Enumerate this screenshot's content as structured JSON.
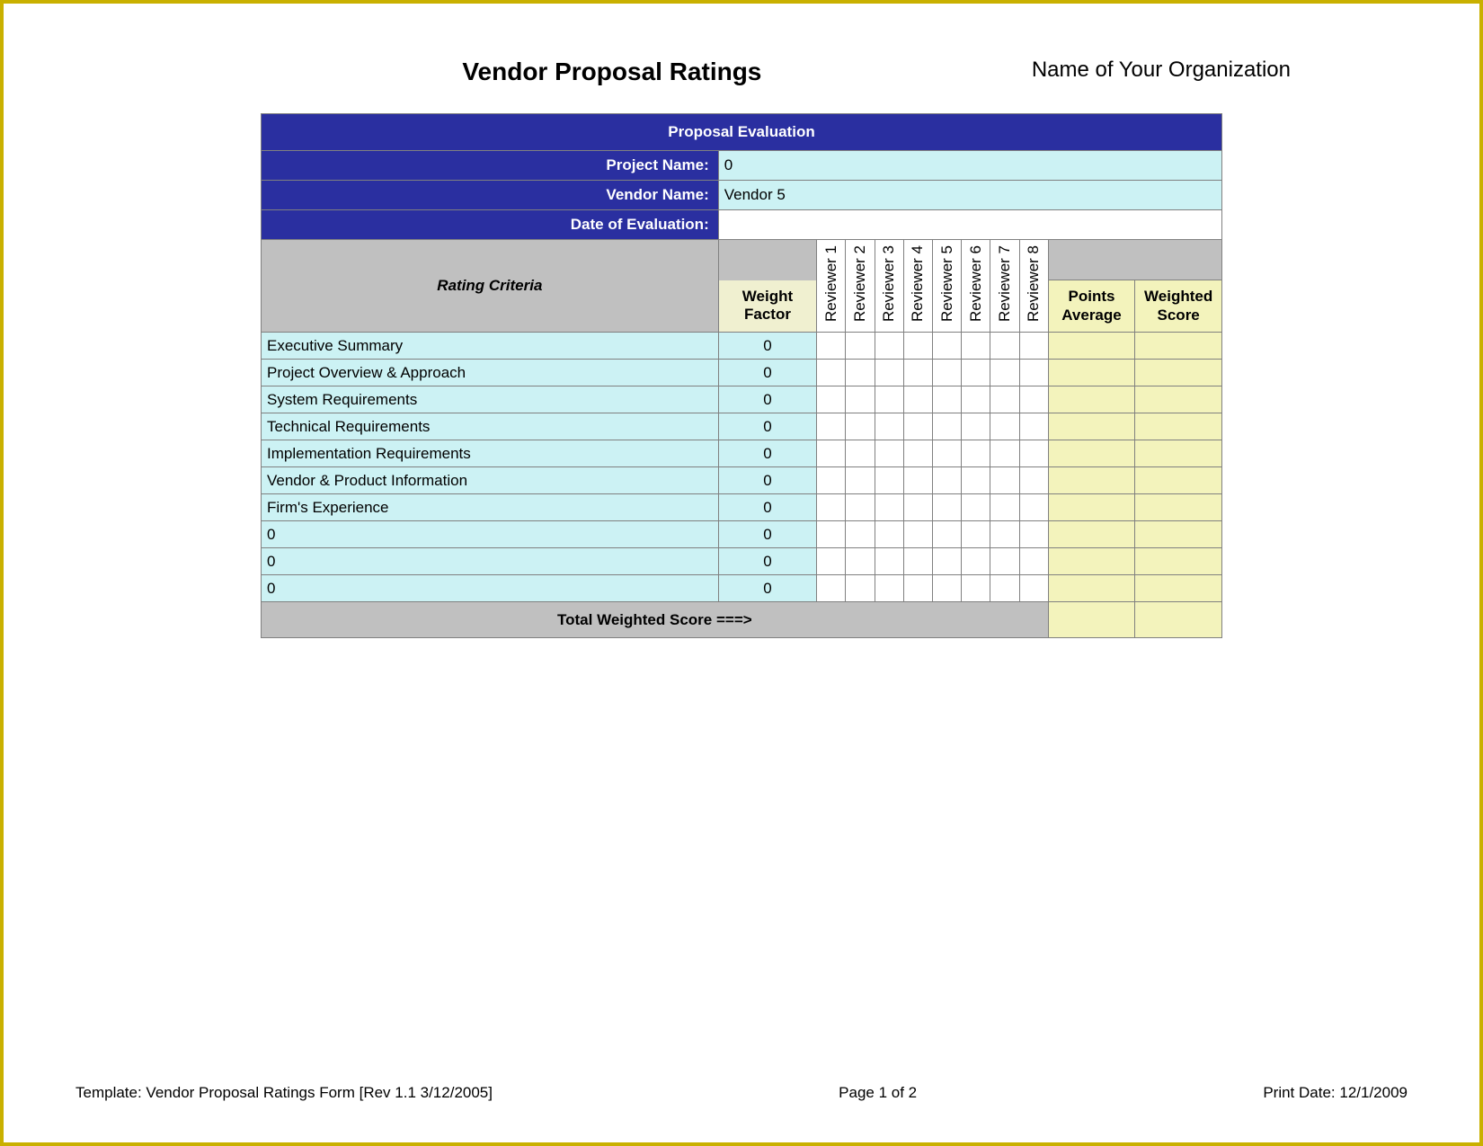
{
  "header": {
    "title": "Vendor Proposal Ratings",
    "org": "Name of Your Organization"
  },
  "banner": "Proposal Evaluation",
  "fields": {
    "project_label": "Project Name:",
    "project_value": "0",
    "vendor_label": "Vendor Name:",
    "vendor_value": "Vendor 5",
    "date_label": "Date of Evaluation:",
    "date_value": ""
  },
  "columns": {
    "criteria": "Rating Criteria",
    "weight": "Weight Factor",
    "reviewers": [
      "Reviewer 1",
      "Reviewer 2",
      "Reviewer 3",
      "Reviewer 4",
      "Reviewer 5",
      "Reviewer 6",
      "Reviewer 7",
      "Reviewer 8"
    ],
    "points_avg": "Points Average",
    "weighted_score": "Weighted Score"
  },
  "rows": [
    {
      "criteria": "Executive Summary",
      "weight": "0"
    },
    {
      "criteria": "Project Overview & Approach",
      "weight": "0"
    },
    {
      "criteria": "System Requirements",
      "weight": "0"
    },
    {
      "criteria": "Technical Requirements",
      "weight": "0"
    },
    {
      "criteria": "Implementation Requirements",
      "weight": "0"
    },
    {
      "criteria": "Vendor & Product Information",
      "weight": "0"
    },
    {
      "criteria": "Firm's Experience",
      "weight": "0"
    },
    {
      "criteria": "0",
      "weight": "0"
    },
    {
      "criteria": "0",
      "weight": "0"
    },
    {
      "criteria": "0",
      "weight": "0"
    }
  ],
  "total_label": "Total Weighted Score ===>",
  "footer": {
    "template": "Template: Vendor Proposal Ratings Form [Rev 1.1 3/12/2005]",
    "page": "Page 1 of 2",
    "print": "Print Date: 12/1/2009"
  }
}
